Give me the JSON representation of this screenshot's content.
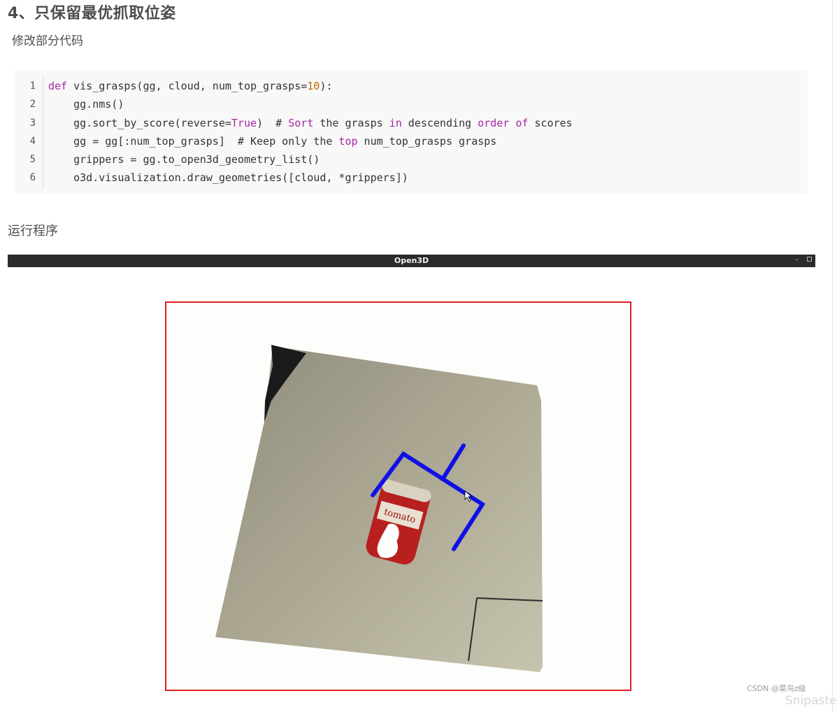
{
  "article": {
    "heading": "4、只保留最优抓取位姿",
    "intro": "修改部分代码",
    "run_label": "运行程序"
  },
  "code": {
    "line_numbers": [
      "1",
      "2",
      "3",
      "4",
      "5",
      "6"
    ],
    "lines": [
      "def vis_grasps(gg, cloud, num_top_grasps=10):",
      "    gg.nms()",
      "    gg.sort_by_score(reverse=True)  # Sort the grasps in descending order of scores",
      "    gg = gg[:num_top_grasps]  # Keep only the top num_top_grasps grasps",
      "    grippers = gg.to_open3d_geometry_list()",
      "    o3d.visualization.draw_geometries([cloud, *grippers])"
    ]
  },
  "window": {
    "title": "Open3D",
    "minimize_glyph": "–"
  },
  "scene": {
    "gripper_color": "#1010e6",
    "highlight_border_color": "#e02020",
    "can_label": "tomato"
  },
  "watermarks": {
    "csdn": "CSDN @菜鸟z级",
    "snipaste": "Snipaste"
  }
}
